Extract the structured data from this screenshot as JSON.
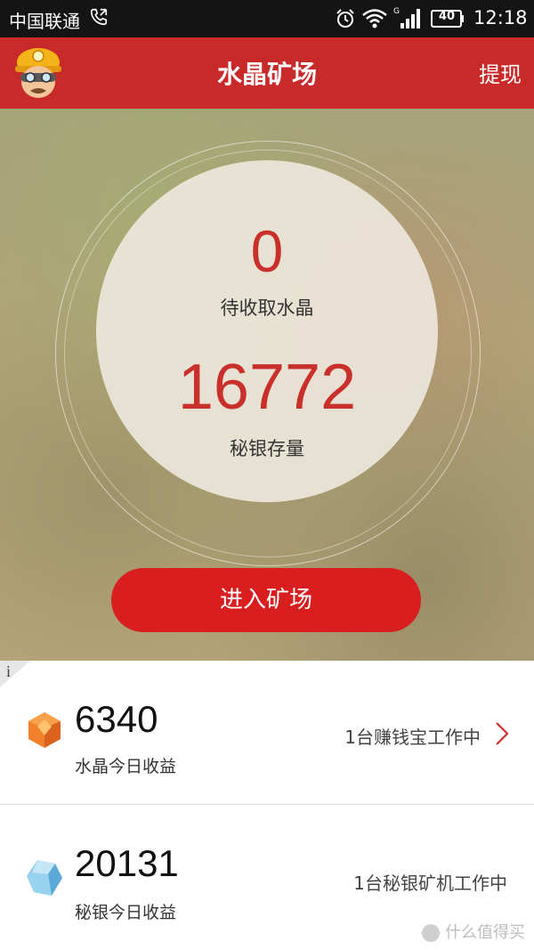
{
  "status_bar": {
    "carrier": "中国联通",
    "battery": "40",
    "time": "12:18"
  },
  "header": {
    "title": "水晶矿场",
    "withdraw_label": "提现"
  },
  "hero": {
    "pending_crystal_value": "0",
    "pending_crystal_label": "待收取水晶",
    "silver_stock_value": "16772",
    "silver_stock_label": "秘银存量",
    "enter_button_label": "进入矿场"
  },
  "info_label": "i",
  "rows": [
    {
      "value": "6340",
      "label": "水晶今日收益",
      "status": "1台赚钱宝工作中",
      "icon": "orange-crystal-icon"
    },
    {
      "value": "20131",
      "label": "秘银今日收益",
      "status": "1台秘银矿机工作中",
      "icon": "blue-crystal-icon"
    }
  ],
  "watermark": "什么值得买",
  "colors": {
    "header": "#c72a28",
    "accent_red": "#d81e1e",
    "value_red": "#c9302c"
  }
}
